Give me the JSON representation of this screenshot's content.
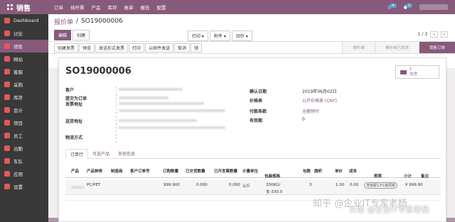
{
  "topbar": {
    "app_name": "销售",
    "menu": [
      "订单",
      "待开票",
      "产品",
      "库存",
      "账单",
      "报告",
      "配置"
    ],
    "notif_count": "4",
    "msg_count": "1"
  },
  "sidebar": {
    "items": [
      {
        "label": "Dashboard",
        "color": "#e05a5a",
        "active": false
      },
      {
        "label": "讨论",
        "color": "#e05a5a",
        "active": false
      },
      {
        "label": "销售",
        "color": "#e05a5a",
        "active": true
      },
      {
        "label": "网站",
        "color": "#e05a5a",
        "active": false
      },
      {
        "label": "客服",
        "color": "#e05a5a",
        "active": false
      },
      {
        "label": "采购",
        "color": "#e05a5a",
        "active": false
      },
      {
        "label": "库存",
        "color": "#e05a5a",
        "active": false
      },
      {
        "label": "会计",
        "color": "#e05a5a",
        "active": false
      },
      {
        "label": "项目",
        "color": "#e05a5a",
        "active": false
      },
      {
        "label": "员工",
        "color": "#e05a5a",
        "active": false
      },
      {
        "label": "出勤",
        "color": "#e05a5a",
        "active": false
      },
      {
        "label": "车队",
        "color": "#e05a5a",
        "active": false
      },
      {
        "label": "应用",
        "color": "#e05a5a",
        "active": false
      },
      {
        "label": "设置",
        "color": "#e05a5a",
        "active": false
      }
    ]
  },
  "breadcrumb": {
    "parent": "报价单",
    "sep": "/",
    "current": "SO19000006"
  },
  "actions": {
    "edit": "编辑",
    "create": "创建",
    "print": "打印 ▾",
    "attachment": "附件 ▾",
    "action": "动作 ▾",
    "pager": "1 / 3"
  },
  "status_buttons": [
    "创建发票",
    "预览",
    "发送形式发票",
    "打印",
    "以邮件发送",
    "取消",
    "锁"
  ],
  "stages": [
    {
      "label": "报价单",
      "active": false
    },
    {
      "label": "报价单已发送",
      "active": false
    },
    {
      "label": "销售订单",
      "active": true
    }
  ],
  "document": {
    "name": "SO19000006",
    "delivery_count": "1",
    "delivery_label": "交货",
    "left_labels": [
      "客户",
      "提交为订单",
      "发票地址",
      "送货地址",
      "物流方式"
    ],
    "right_labels": [
      "确认日期",
      "价格表",
      "付款条款",
      "有效期"
    ],
    "confirm_date": "2019年06月02日",
    "pricelist": "公开价格表 (CNY)",
    "payment_terms": "全额预付",
    "validity": "0"
  },
  "tabs": [
    "订单行",
    "可选产品",
    "其他信息"
  ],
  "table": {
    "headers": [
      "产品",
      "产品种类",
      "制造商",
      "客户订单号",
      "订购数量",
      "已交货数量",
      "已开发票数量",
      "计量单位",
      "包装规格",
      "包数",
      "旗帜",
      "单价",
      "成本",
      "税率",
      "小计",
      "备注"
    ],
    "row": {
      "category": "PC/PET",
      "qty": "999.900",
      "delivered": "0.000",
      "invoiced": "0.000",
      "uom": "公斤",
      "pack_spec_1": "330KG/",
      "pack_spec_2": "支-330.0",
      "packs": "3",
      "unit_price": "1.00",
      "cost": "0.00",
      "tax": "增值税13%销项税",
      "subtotal": "¥ 999.90"
    }
  },
  "watermark": {
    "line1": "知乎 @企业IT专家老杨",
    "line2": "头条 @企业IT专家老杨"
  }
}
